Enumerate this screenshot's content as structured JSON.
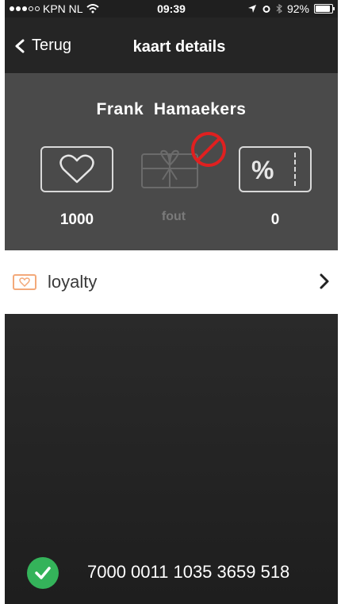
{
  "status_bar": {
    "carrier": "KPN NL",
    "time": "09:39",
    "battery": "92%"
  },
  "nav": {
    "back_label": "Terug",
    "title": "kaart details"
  },
  "card": {
    "holder_name": "Frank  Hamaekers",
    "stats": [
      {
        "icon": "heart-icon",
        "value": "1000"
      },
      {
        "icon": "gift-card-icon",
        "value": "fout",
        "disabled": true
      },
      {
        "icon": "percent-icon",
        "value": "0"
      }
    ]
  },
  "loyalty_row": {
    "label": "loyalty",
    "icon": "heart-badge-icon"
  },
  "card_number": {
    "value": "7000 0011 1035 3659 518",
    "status_icon": "check-icon"
  },
  "colors": {
    "accent_green": "#34b35a",
    "badge_orange": "#f3a97a",
    "forbidden_red": "#e02020"
  }
}
